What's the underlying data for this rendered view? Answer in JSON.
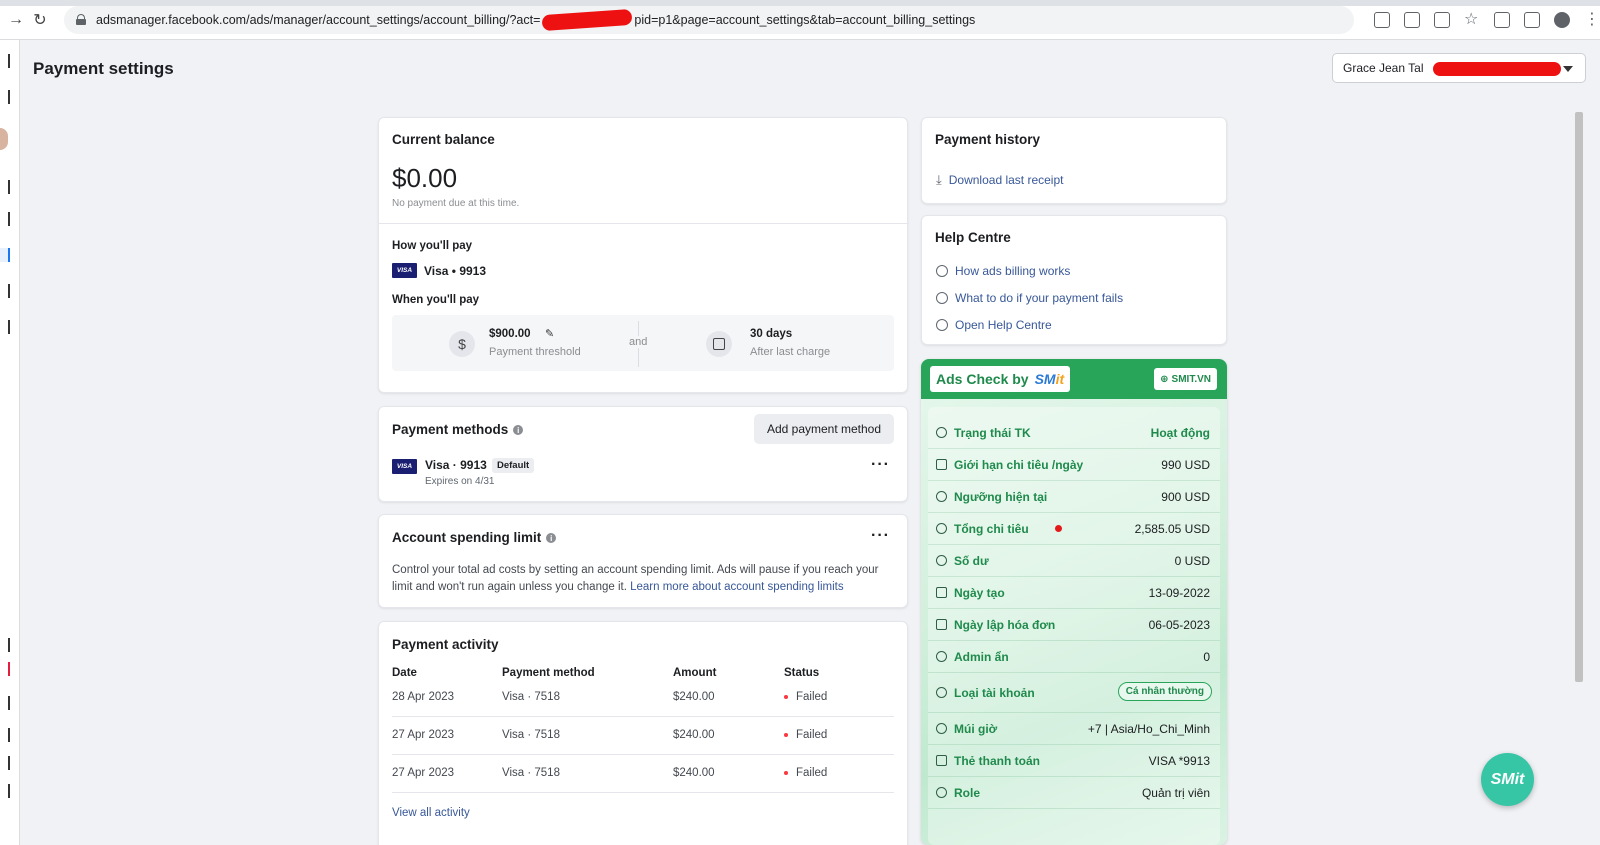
{
  "browser": {
    "url_start": "adsmanager.facebook.com/ads/manager/account_settings/account_billing/?act=",
    "url_end": "pid=p1&page=account_settings&tab=account_billing_settings"
  },
  "header": {
    "title": "Payment settings",
    "account_name": "Grace Jean Tal"
  },
  "balance": {
    "title": "Current balance",
    "amount": "$0.00",
    "note": "No payment due at this time.",
    "how_label": "How you'll pay",
    "card": "Visa • 9913",
    "when_label": "When you'll pay",
    "threshold_value": "$900.00",
    "threshold_label": "Payment threshold",
    "and": "and",
    "days_value": "30 days",
    "days_label": "After last charge"
  },
  "methods": {
    "title": "Payment methods",
    "add_button": "Add payment method",
    "card": "Visa · 9913",
    "default_badge": "Default",
    "expires": "Expires on 4/31",
    "visa_logo": "VISA"
  },
  "spending": {
    "title": "Account spending limit",
    "description": "Control your total ad costs by setting an account spending limit. Ads will pause if you reach your limit and won't run again unless you change it.",
    "link": "Learn more about account spending limits"
  },
  "activity": {
    "title": "Payment activity",
    "headers": [
      "Date",
      "Payment method",
      "Amount",
      "Status"
    ],
    "rows": [
      {
        "date": "28 Apr 2023",
        "method": "Visa · 7518",
        "amount": "$240.00",
        "status": "Failed"
      },
      {
        "date": "27 Apr 2023",
        "method": "Visa · 7518",
        "amount": "$240.00",
        "status": "Failed"
      },
      {
        "date": "27 Apr 2023",
        "method": "Visa · 7518",
        "amount": "$240.00",
        "status": "Failed"
      }
    ],
    "view_all": "View all activity"
  },
  "history": {
    "title": "Payment history",
    "download": "Download last receipt"
  },
  "help": {
    "title": "Help Centre",
    "links": [
      "How ads billing works",
      "What to do if your payment fails",
      "Open Help Centre"
    ]
  },
  "smit": {
    "title": "Ads Check by",
    "brand_a": "SM",
    "brand_b": "it",
    "site": "SMIT.VN",
    "fab": "SMit",
    "rows": [
      {
        "label": "Trạng thái TK",
        "value": "Hoạt động"
      },
      {
        "label": "Giới hạn chi tiêu /ngày",
        "value": "990 USD"
      },
      {
        "label": "Ngưỡng hiện tại",
        "value": "900 USD"
      },
      {
        "label": "Tổng chi tiêu",
        "value": "2,585.05 USD"
      },
      {
        "label": "Số dư",
        "value": "0 USD"
      },
      {
        "label": "Ngày tạo",
        "value": "13-09-2022"
      },
      {
        "label": "Ngày lập hóa đơn",
        "value": "06-05-2023"
      },
      {
        "label": "Admin ẩn",
        "value": "0"
      },
      {
        "label": "Loại tài khoản",
        "value": "Cá nhân thường"
      },
      {
        "label": "Múi giờ",
        "value": "+7 | Asia/Ho_Chi_Minh"
      },
      {
        "label": "Thẻ thanh toán",
        "value": "VISA *9913"
      },
      {
        "label": "Role",
        "value": "Quản trị viên"
      }
    ],
    "status_color": "#1f8a4c"
  }
}
